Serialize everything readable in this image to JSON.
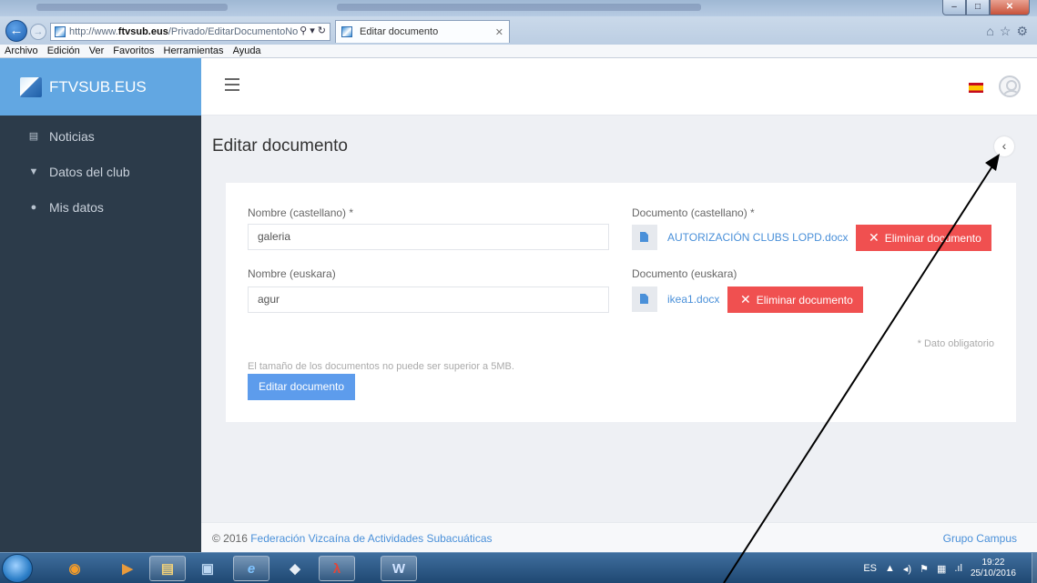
{
  "browser": {
    "url_prefix": "http://www.",
    "url_domain": "ftvsub.eus",
    "url_path": "/Privado/EditarDocumentoNoti",
    "tab_title": "Editar documento",
    "menu": [
      "Archivo",
      "Edición",
      "Ver",
      "Favoritos",
      "Herramientas",
      "Ayuda"
    ]
  },
  "app": {
    "brand": "FTVSUB.EUS",
    "nav": [
      {
        "label": "Noticias",
        "icon": "newspaper-icon"
      },
      {
        "label": "Datos del club",
        "icon": "shield-icon"
      },
      {
        "label": "Mis datos",
        "icon": "user-icon"
      }
    ],
    "page_title": "Editar documento"
  },
  "form": {
    "name_es_label": "Nombre (castellano) *",
    "name_es_value": "galeria",
    "name_eu_label": "Nombre (euskara)",
    "name_eu_value": "agur",
    "doc_es_label": "Documento (castellano) *",
    "doc_es_file": "AUTORIZACIÓN CLUBS LOPD.docx",
    "doc_eu_label": "Documento (euskara)",
    "doc_eu_file": "ikea1.docx",
    "delete_label": "Eliminar documento",
    "required_note": "* Dato obligatorio",
    "size_note": "El tamaño de los documentos no puede ser superior a 5MB.",
    "submit_label": "Editar documento"
  },
  "footer": {
    "copyright": "© 2016 ",
    "org_link": "Federación Vizcaína de Actividades Subacuáticas",
    "credit": "Grupo Campus"
  },
  "taskbar": {
    "lang": "ES",
    "time": "19:22",
    "date": "25/10/2016"
  },
  "colors": {
    "brand_blue": "#62a7e2",
    "sidebar": "#2c3b4a",
    "danger": "#f05050",
    "primary": "#5d9cec",
    "link": "#4a90d9"
  }
}
